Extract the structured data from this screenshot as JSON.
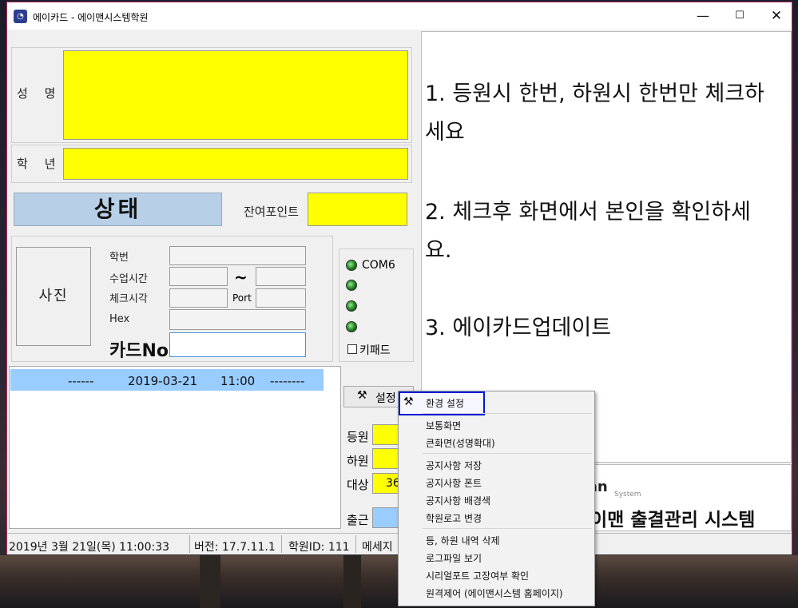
{
  "window": {
    "title": "에이카드 - 에이맨시스템학원",
    "icon": "app-logo-icon",
    "controls": {
      "minimize": "—",
      "maximize": "☐",
      "close": "✕"
    }
  },
  "student": {
    "name_label": "성 명",
    "name_value": "",
    "grade_label": "학 년",
    "grade_value": "",
    "status_label": "상태",
    "points_label": "잔여포인트",
    "points_value": "",
    "photo_label": "사진",
    "student_no_label": "학번",
    "class_time_label": "수업시간",
    "tilde": "~",
    "check_time_label": "체크시각",
    "port_label": "Port",
    "hex_label": "Hex",
    "card_no_label": "카드No"
  },
  "com": {
    "port_label": "COM6",
    "keypad_label": "키패드",
    "keypad_checked": false
  },
  "log": {
    "rows": [
      {
        "prefix": "------",
        "date": "2019-03-21",
        "time": "11:00",
        "suffix": "--------"
      }
    ]
  },
  "controls": {
    "setting_label": "설정",
    "in_label": "등원",
    "out_label": "하원",
    "target_label": "대상",
    "target_value": "36",
    "work_label": "출근"
  },
  "notice": {
    "lines": [
      "1. 등원시 한번, 하원시 한번만 체크하",
      "세요",
      "2. 체크후 화면에서 본인을 확인하세",
      "요.",
      "3. 에이카드업데이트"
    ]
  },
  "branding": {
    "logo_name": "man",
    "logo_sub": "System",
    "system_title": "이맨 출결관리 시스템"
  },
  "statusbar": {
    "datetime": "2019년 3월 21일(목) 11:00:33",
    "version": "버전: 17.7.11.1",
    "academy_id": "학원ID: 111",
    "message": "메세지"
  },
  "context_menu": {
    "items": [
      "환경 설정",
      "보통화면",
      "큰화면(성명확대)",
      "공지사항 저장",
      "공지사항 폰트",
      "공지사항 배경색",
      "학원로고 변경",
      "등, 하원 내역 삭제",
      "로그파일 보기",
      "시리얼포트 고장여부 확인",
      "원격제어 (에이맨시스템 홈페이지)"
    ],
    "highlight_color": "#0018d6"
  },
  "colors": {
    "yellow": "#ffff00",
    "status_blue": "#b8cfe8",
    "row_blue": "#99ccff",
    "window_border": "#b02a5a"
  }
}
